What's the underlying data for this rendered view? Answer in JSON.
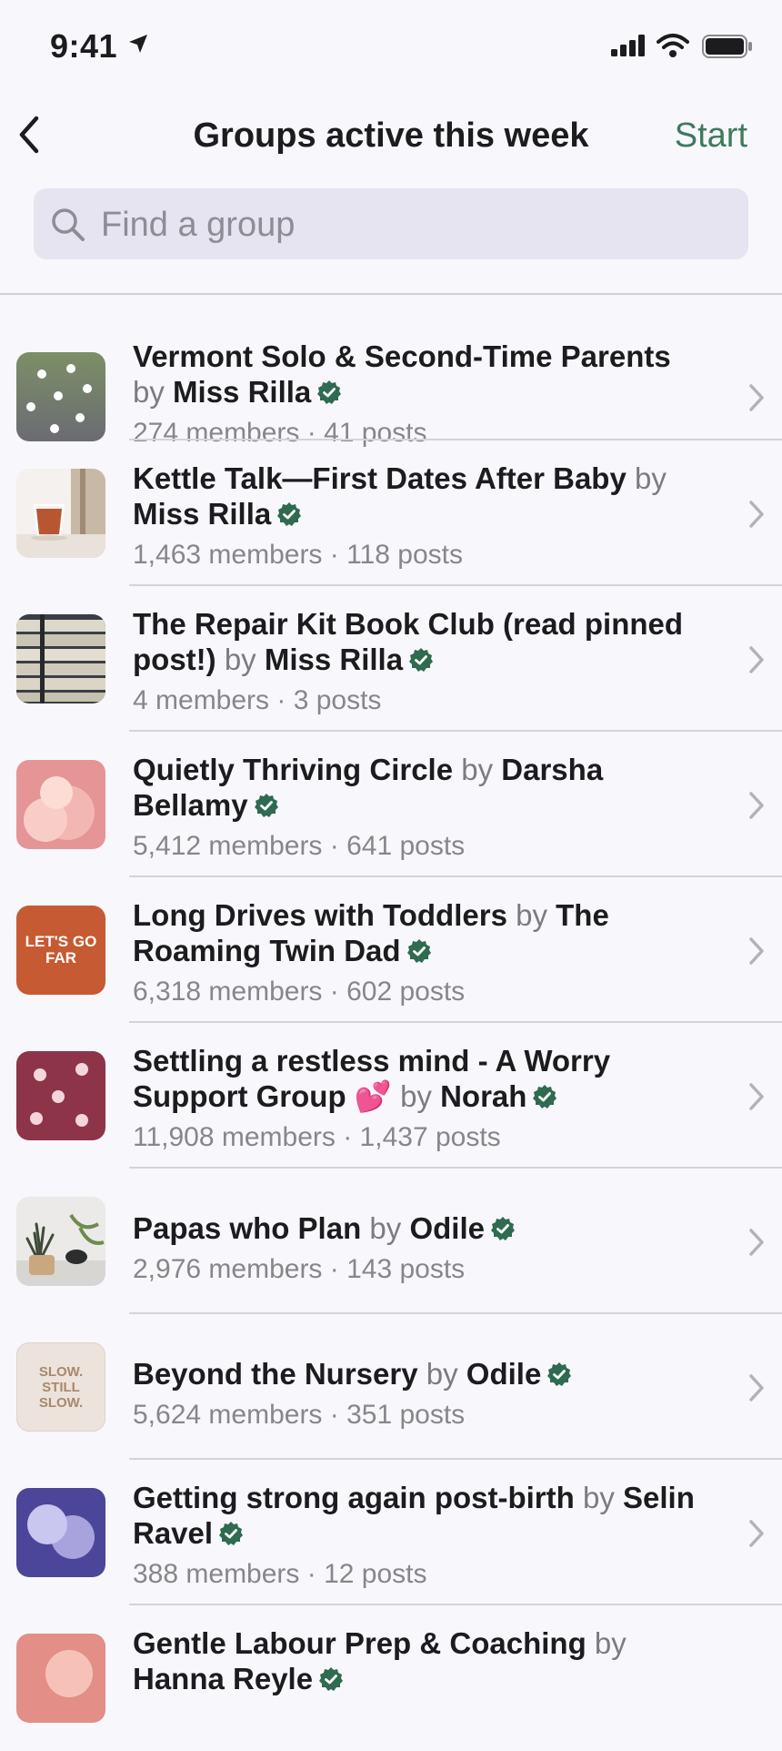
{
  "status": {
    "time": "9:41"
  },
  "nav": {
    "title": "Groups active this week",
    "start": "Start"
  },
  "search": {
    "placeholder": "Find a group"
  },
  "by_word": "by",
  "groups": [
    {
      "name": "Vermont Solo & Second-Time Parents",
      "owner": "Miss Rilla",
      "stats": "274 members · 41 posts"
    },
    {
      "name": "Kettle Talk—First Dates After Baby",
      "owner": "Miss Rilla",
      "stats": "1,463 members · 118 posts"
    },
    {
      "name": "The Repair Kit Book Club (read pinned post!)",
      "owner": "Miss Rilla",
      "stats": "4 members · 3 posts"
    },
    {
      "name": "Quietly Thriving Circle",
      "owner": "Darsha Bellamy",
      "stats": "5,412 members · 641 posts"
    },
    {
      "name": "Long Drives with Toddlers",
      "owner": "The Roaming Twin Dad",
      "stats": "6,318 members · 602 posts",
      "thumb_text": "LET'S GO FAR"
    },
    {
      "name": "Settling a restless mind - A Worry Support Group 💕",
      "owner": "Norah",
      "stats": "11,908 members · 1,437 posts"
    },
    {
      "name": "Papas who Plan",
      "owner": "Odile",
      "stats": "2,976 members · 143 posts"
    },
    {
      "name": "Beyond the Nursery",
      "owner": "Odile",
      "stats": "5,624 members · 351 posts",
      "thumb_text": "SLOW. STILL SLOW."
    },
    {
      "name": "Getting strong again post-birth",
      "owner": "Selin Ravel",
      "stats": "388 members · 12 posts"
    },
    {
      "name": "Gentle Labour Prep & Coaching",
      "owner": "Hanna Reyle",
      "stats": ""
    }
  ],
  "colors": {
    "accent": "#3f7a5e",
    "verified": "#2f6b50"
  }
}
